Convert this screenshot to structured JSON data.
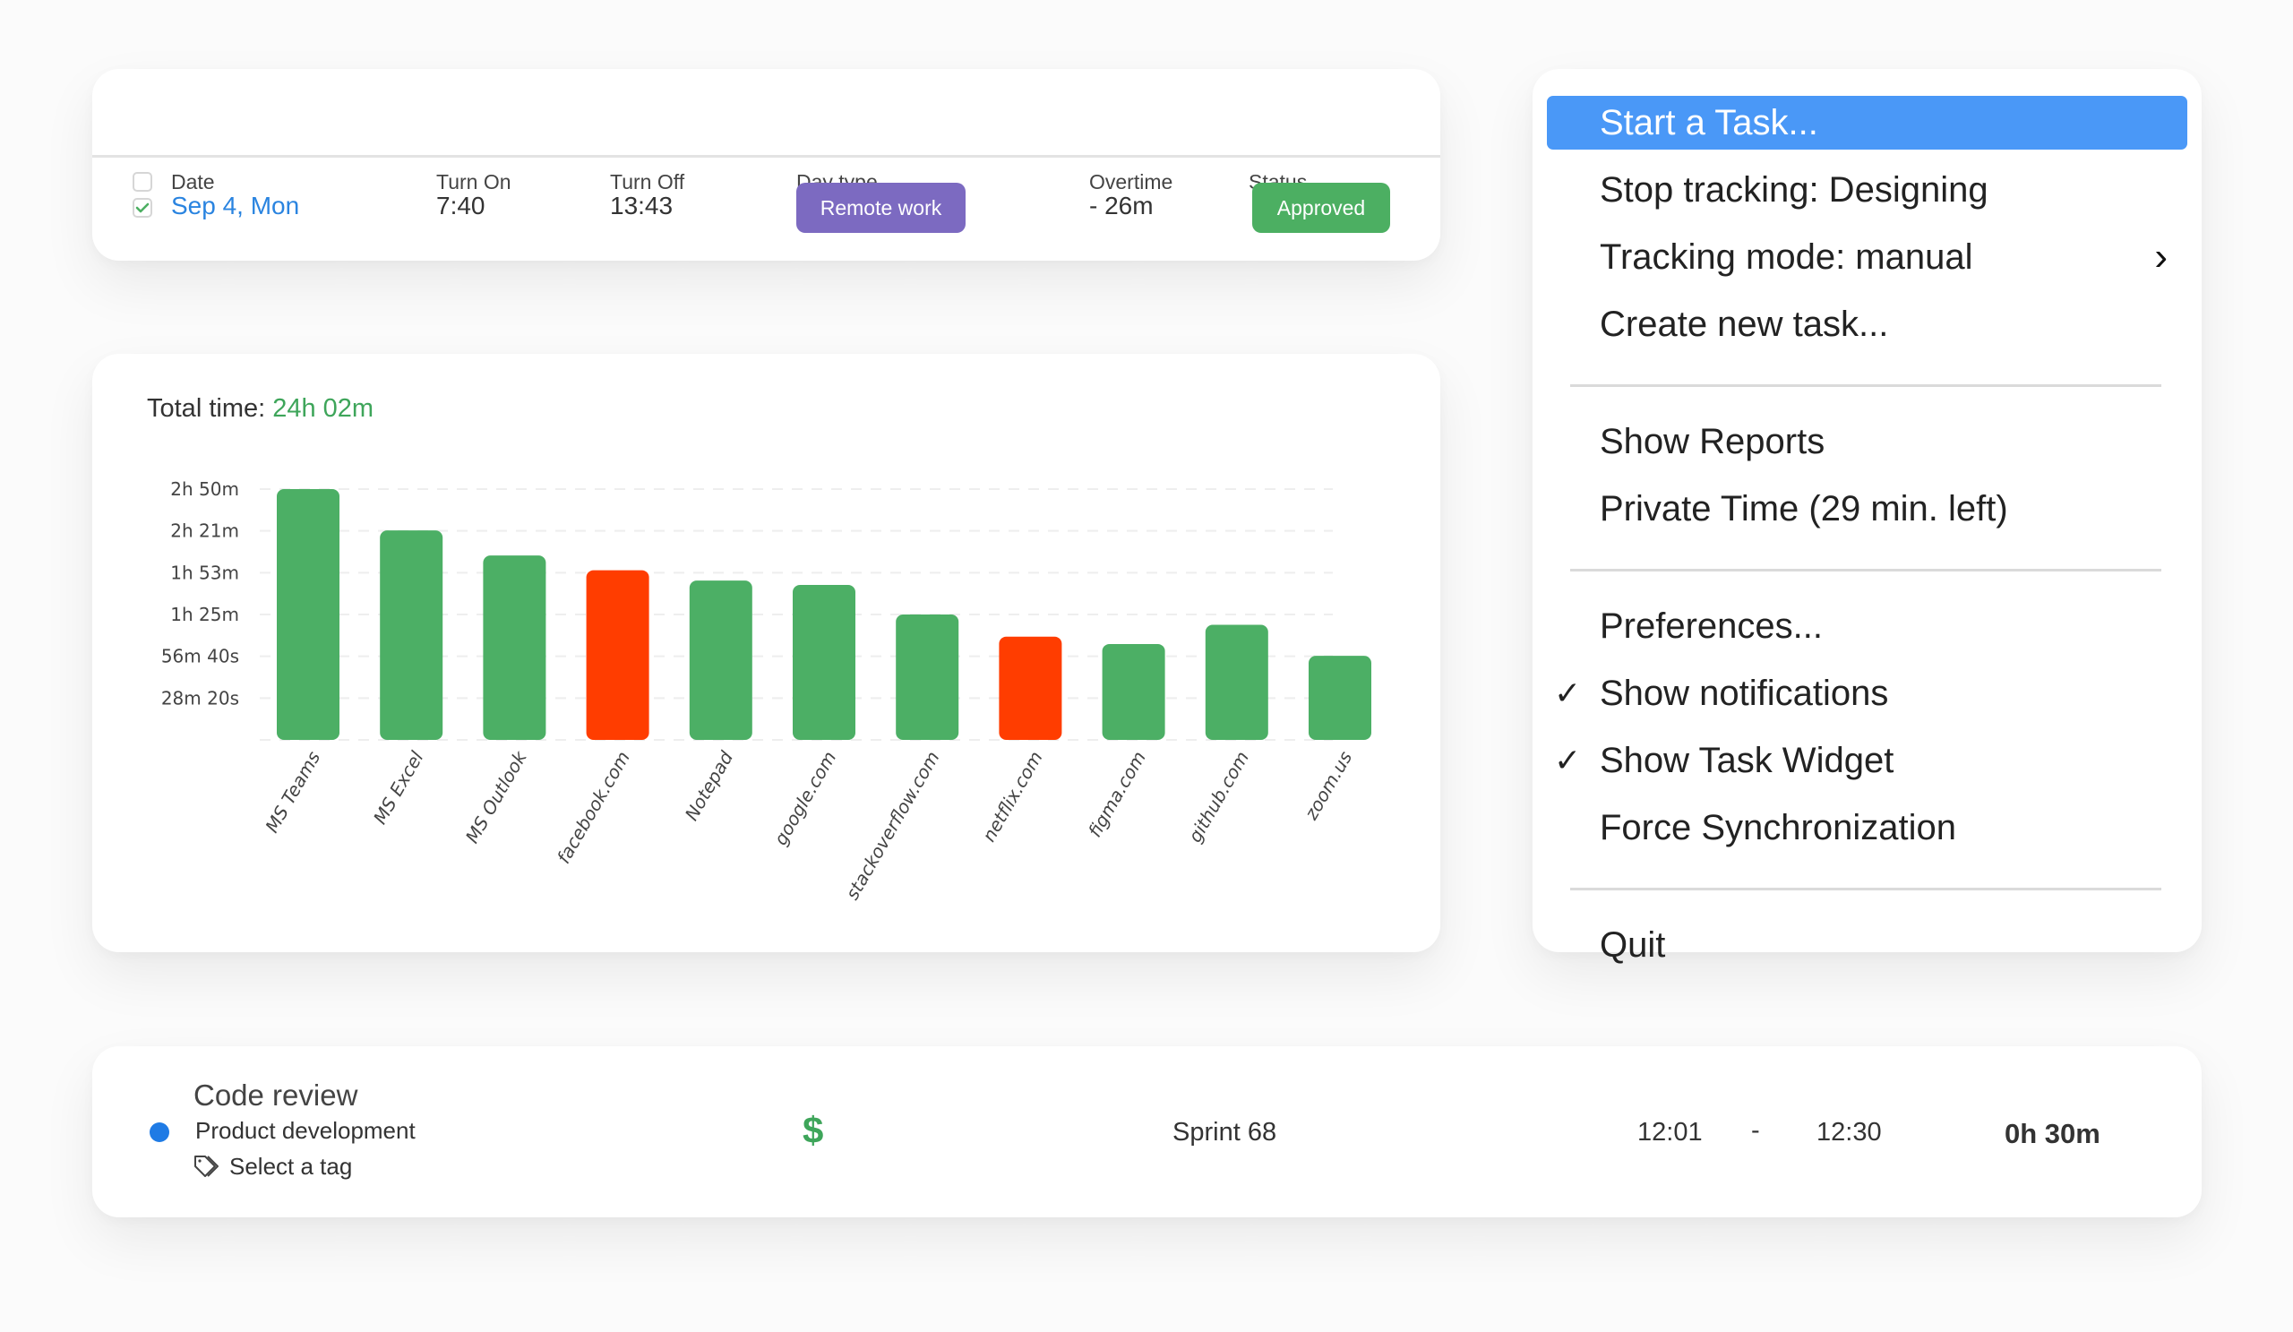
{
  "attendance_table": {
    "columns": [
      "Date",
      "Turn On",
      "Turn Off",
      "Day type",
      "Overtime",
      "Status"
    ],
    "rows": [
      {
        "checked": true,
        "date": "Sep 4, Mon",
        "turn_on": "7:40",
        "turn_off": "13:43",
        "day_type": "Remote work",
        "overtime": "- 26m",
        "status": "Approved"
      }
    ],
    "colors": {
      "date_link": "#2a84e0",
      "day_type_badge": "#7c6ac1",
      "status_badge": "#4caf62",
      "checkmark": "#4caf62"
    }
  },
  "chart_card": {
    "total_label": "Total time:",
    "total_value": "24h 02m"
  },
  "chart_data": {
    "type": "bar",
    "title": "Total time: 24h 02m",
    "xlabel": "",
    "ylabel": "",
    "categories": [
      "MS Teams",
      "MS Excel",
      "MS Outlook",
      "facebook.com",
      "Notepad",
      "google.com",
      "stackoverflow.com",
      "netflix.com",
      "figma.com",
      "github.com",
      "zoom.us"
    ],
    "values_minutes": [
      170,
      142,
      125,
      115,
      108,
      105,
      85,
      70,
      65,
      78,
      57
    ],
    "bar_colors": [
      "#4caf65",
      "#4caf65",
      "#4caf65",
      "#ff3d00",
      "#4caf65",
      "#4caf65",
      "#4caf65",
      "#ff3d00",
      "#4caf65",
      "#4caf65",
      "#4caf65"
    ],
    "y_ticks_minutes": [
      28.333,
      56.667,
      85,
      113.333,
      141.667,
      170
    ],
    "y_tick_labels": [
      "28m 20s",
      "56m 40s",
      "1h 25m",
      "1h 53m",
      "2h 21m",
      "2h 50m"
    ],
    "ylim_minutes": [
      0,
      170
    ],
    "grid": true,
    "grid_style": "dashed",
    "legend": "none",
    "x_label_rotation_deg": -60
  },
  "tray_menu": {
    "items": [
      {
        "label": "Start a Task...",
        "highlighted": true
      },
      {
        "label": "Stop tracking: Designing"
      },
      {
        "label": "Tracking mode: manual",
        "submenu": true
      },
      {
        "label": "Create new task..."
      },
      {
        "separator": true
      },
      {
        "label": "Show Reports"
      },
      {
        "label": "Private Time (29 min. left)"
      },
      {
        "separator": true
      },
      {
        "label": "Preferences..."
      },
      {
        "label": "Show notifications",
        "checked": true
      },
      {
        "label": "Show Task Widget",
        "checked": true
      },
      {
        "label": "Force Synchronization"
      },
      {
        "separator": true
      },
      {
        "label": "Quit"
      }
    ],
    "check_glyph": "✓",
    "submenu_glyph": "›",
    "highlight_color": "#4a98f7"
  },
  "task_entry": {
    "title": "Code review",
    "project": "Product development",
    "project_color": "#1f7be5",
    "tag_placeholder": "Select a tag",
    "billable_icon": "$",
    "billable_color": "#3ea55a",
    "sprint": "Sprint 68",
    "start": "12:01",
    "separator": "-",
    "end": "12:30",
    "duration": "0h 30m"
  }
}
